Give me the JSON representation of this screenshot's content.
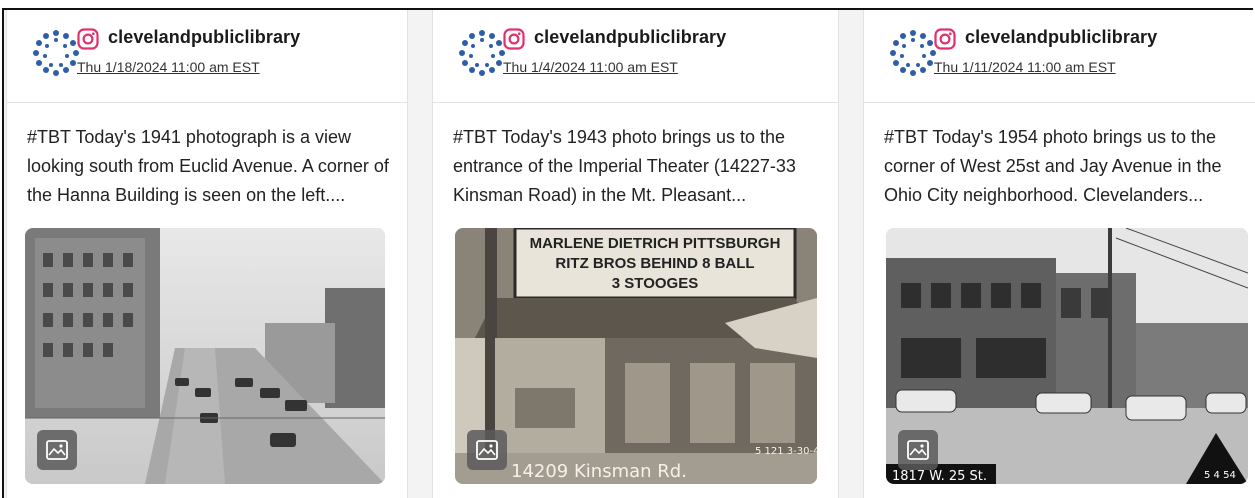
{
  "posts": [
    {
      "username": "clevelandpubliclibrary",
      "timestamp": "Thu 1/18/2024 11:00 am EST",
      "caption": "#TBT Today's 1941 photograph is a view looking south from Euclid Avenue. A corner of the Hanna Building is seen on the left....",
      "photo_overlay_text": ""
    },
    {
      "username": "clevelandpubliclibrary",
      "timestamp": "Thu 1/4/2024 11:00 am EST",
      "caption": "#TBT Today's 1943 photo brings us to the entrance of the Imperial Theater (14227-33 Kinsman Road) in the Mt. Pleasant...",
      "photo_overlay_text": "14209 Kinsman Rd."
    },
    {
      "username": "clevelandpubliclibrary",
      "timestamp": "Thu 1/11/2024 11:00 am EST",
      "caption": "#TBT Today's 1954 photo brings us to the corner of West 25st and Jay Avenue in the Ohio City neighborhood. Clevelanders...",
      "photo_overlay_text": "1817 W. 25 St."
    }
  ],
  "marquee_lines": [
    "MARLENE DIETRICH PITTSBURGH",
    "RITZ BROS BEHIND 8 BALL",
    "3 STOOGES"
  ],
  "photo_corner_marks": [
    "5 4 54",
    "5 121 3-30-43"
  ],
  "icons": {
    "avatar": "library-logo-icon",
    "platform": "instagram-icon",
    "media": "image-icon"
  },
  "colors": {
    "instagram": "#e1306c",
    "logo_blue": "#2f5ea8"
  }
}
